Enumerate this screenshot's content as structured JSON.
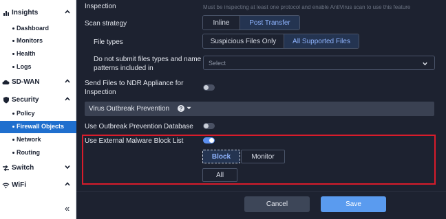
{
  "sidebar": {
    "sections": [
      {
        "label": "Insights",
        "icon": "bar-chart-icon",
        "chevron": "up"
      },
      {
        "label": "SD-WAN",
        "icon": "cloud-icon",
        "chevron": "up"
      },
      {
        "label": "Security",
        "icon": "shield-icon",
        "chevron": "up"
      },
      {
        "label": "Switch",
        "icon": "switch-icon",
        "chevron": "down"
      },
      {
        "label": "WiFi",
        "icon": "wifi-icon",
        "chevron": "up"
      }
    ],
    "items": [
      {
        "label": "Dashboard",
        "active": false
      },
      {
        "label": "Monitors",
        "active": false
      },
      {
        "label": "Health",
        "active": false
      },
      {
        "label": "Logs",
        "active": false
      },
      {
        "label": "Policy",
        "active": false
      },
      {
        "label": "Firewall Objects",
        "active": true
      },
      {
        "label": "Network",
        "active": false
      },
      {
        "label": "Routing",
        "active": false
      }
    ],
    "collapse_glyph": "«"
  },
  "form": {
    "inspection": {
      "label": "Inspection",
      "hint": "Must be inspecting at least one protocol and enable AntiVirus scan to use this feature"
    },
    "scan_strategy": {
      "label": "Scan strategy",
      "options": [
        "Inline",
        "Post Transfer"
      ],
      "selected": "Post Transfer"
    },
    "file_types": {
      "label": "File types",
      "options": [
        "Suspicious Files Only",
        "All Supported Files"
      ],
      "selected": "All Supported Files"
    },
    "do_not_submit": {
      "label": "Do not submit files types and name patterns included in",
      "placeholder": "Select"
    },
    "send_to_ndr": {
      "label": "Send Files to NDR Appliance for Inspection",
      "enabled": false
    },
    "virus_outbreak": {
      "label": "Virus Outbreak Prevention"
    },
    "use_outbreak_db": {
      "label": "Use Outbreak Prevention Database",
      "enabled": false
    },
    "use_external_malware": {
      "label": "Use External Malware Block List",
      "enabled": true,
      "options": [
        "Block",
        "Monitor"
      ],
      "selected": "Block",
      "scope": "All"
    }
  },
  "footer": {
    "cancel_label": "Cancel",
    "save_label": "Save"
  },
  "colors": {
    "accent": "#5a9bef",
    "active_nav": "#1f6fce",
    "highlight": "#d91c2b",
    "background": "#1d2230"
  }
}
